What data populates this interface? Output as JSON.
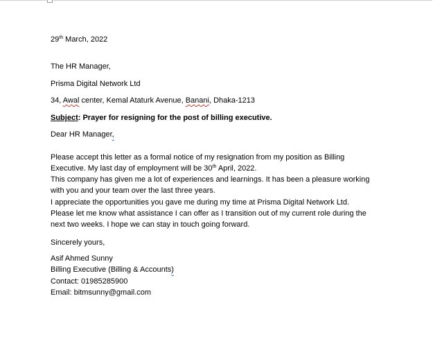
{
  "letter": {
    "date_day": "29",
    "date_suffix": "th",
    "date_rest": " March, 2022",
    "recipient": "The HR Manager,",
    "company": "Prisma Digital Network Ltd",
    "address_prefix": "34, ",
    "address_awal": "Awal",
    "address_middle": " center, Kemal Ataturk Avenue, ",
    "address_banani": "Banani",
    "address_suffix": ", Dhaka-1213",
    "subject_label": "Subject",
    "subject_text": ": Prayer for resigning for the post of billing executive.",
    "salutation": "Dear HR Manager",
    "salutation_comma": ",",
    "body_line_1": "Please accept this letter as a formal notice of my resignation from my position as Billing",
    "body_line_2_pre": "Executive. My last day of employment will be 30",
    "body_line_2_sup": "th",
    "body_line_2_post": " April, 2022.",
    "body_line_3": "This company has given me a lot of experiences and learnings. It has been a pleasure working",
    "body_line_4": "with you and your team over the last three years.",
    "body_line_5": "I appreciate the opportunities you gave me during my time at Prisma Digital Network Ltd.",
    "body_line_6": "Please let me know what assistance I can offer as I transition out of my current role during the",
    "body_line_7": "next two weeks. I hope we can stay in touch going forward.",
    "closing": "Sincerely yours,",
    "sender_name": "Asif Ahmed Sunny",
    "sender_title_main": "Billing Executive (Billing & Accounts",
    "sender_title_close": ")",
    "contact": "Contact: 01985285900",
    "email": "Email: bitmsunny@gmail.com"
  }
}
